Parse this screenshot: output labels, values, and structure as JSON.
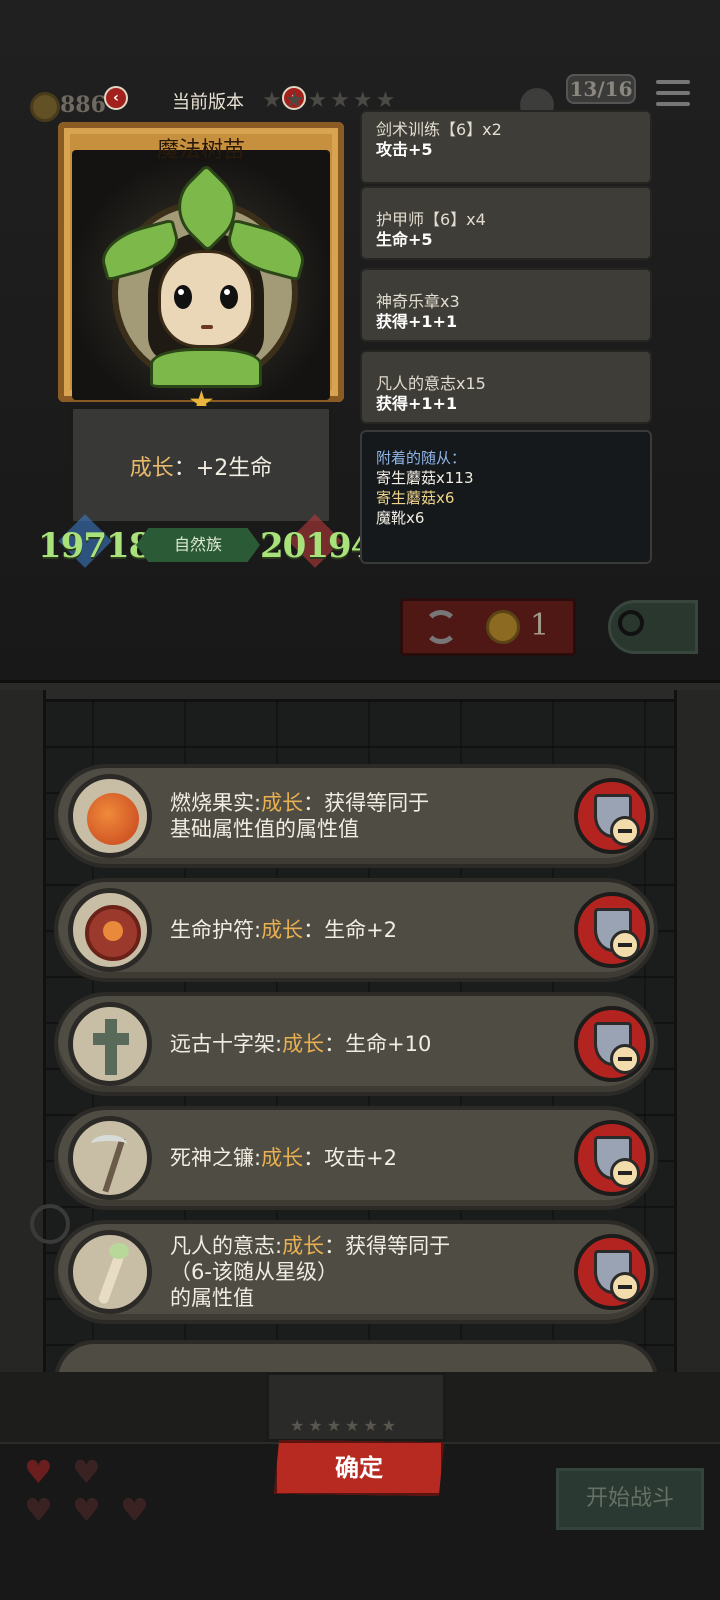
{
  "hud": {
    "coins": "886",
    "version_label": "当前版本",
    "prev_arrow": "‹",
    "next_arrow": "›",
    "stars": "★★★★★★",
    "counter": "13/16"
  },
  "hero": {
    "name": "魔法树苗",
    "growth_label": "成长",
    "growth_colon": "：",
    "growth_value": "+2生命",
    "attack": "19718",
    "health": "20194",
    "tribe": "自然族",
    "star": "★"
  },
  "buffs": [
    {
      "title": "剑术训练【6】x2",
      "value": "攻击+5"
    },
    {
      "title": "护甲师【6】x4",
      "value": "生命+5"
    },
    {
      "title": "神奇乐章x3",
      "value": "获得+1+1"
    },
    {
      "title": "凡人的意志x15",
      "value": "获得+1+1"
    }
  ],
  "attached": {
    "title": "附着的随从：",
    "lines": [
      "寄生蘑菇x113",
      "寄生蘑菇x6",
      "魔靴x6"
    ]
  },
  "reroll": {
    "cost": "1"
  },
  "items": [
    {
      "name": "燃烧果实:",
      "keyword": "成长",
      "desc1": "：获得等同于",
      "desc2": "基础属性值的属性值",
      "icon": "burning-fruit-icon"
    },
    {
      "name": "生命护符:",
      "keyword": "成长",
      "desc1": "：生命+2",
      "icon": "life-amulet-icon"
    },
    {
      "name": "远古十字架:",
      "keyword": "成长",
      "desc1": "：生命+10",
      "icon": "ancient-cross-icon"
    },
    {
      "name": "死神之镰:",
      "keyword": "成长",
      "desc1": "：攻击+2",
      "icon": "death-scythe-icon"
    },
    {
      "name": "凡人的意志:",
      "keyword": "成长",
      "desc1": "：获得等同于",
      "desc2": "（6-该随从星级）",
      "desc3": "的属性值",
      "icon": "mortal-will-icon"
    }
  ],
  "bottom": {
    "confirm": "确定",
    "start_battle": "开始战斗",
    "stars": "★★★★★★"
  },
  "colors": {
    "accent_gold": "#e8b050",
    "stat_green": "#a9e27a",
    "confirm_red": "#b62a22",
    "attached_title_blue": "#8fb4e6"
  }
}
